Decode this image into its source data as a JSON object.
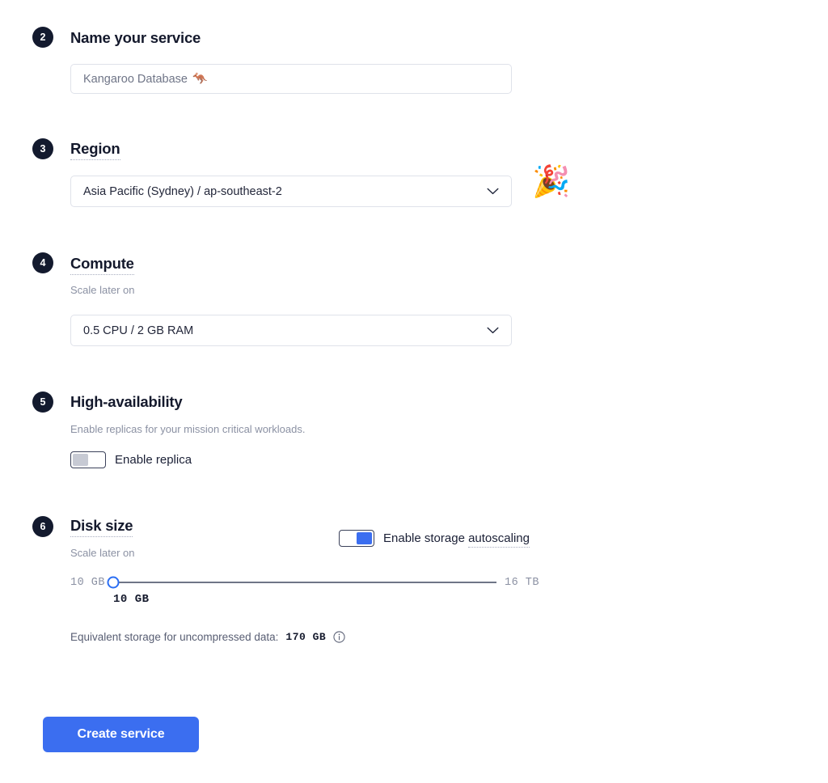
{
  "page": {
    "background": "#ffffff",
    "accent_color": "#3b6ef0",
    "badge_color": "#131a2e",
    "muted_color": "#8b91a3"
  },
  "sections": {
    "name": {
      "step": "2",
      "heading": "Name your service",
      "input_value": "Kangaroo Database",
      "input_emoji": "🦘",
      "input_placeholder": "Kangaroo Database 🦘"
    },
    "region": {
      "step": "3",
      "heading": "Region",
      "selected": "Asia Pacific (Sydney) / ap-southeast-2",
      "side_emoji": "🎉"
    },
    "compute": {
      "step": "4",
      "heading": "Compute",
      "subtitle": "Scale later on",
      "selected": "0.5 CPU / 2 GB RAM"
    },
    "high_availability": {
      "step": "5",
      "heading": "High-availability",
      "subtitle": "Enable replicas for your mission critical workloads.",
      "toggle_label": "Enable replica",
      "toggle_state": "off"
    },
    "disk_size": {
      "step": "6",
      "heading": "Disk size",
      "subtitle": "Scale later on",
      "autoscaling_label_prefix": "Enable storage ",
      "autoscaling_label_suffix": "autoscaling",
      "autoscaling_state": "on",
      "slider": {
        "min_label": "10 GB",
        "max_label": "16 TB",
        "current_label": "10 GB",
        "percent": 0
      },
      "equivalent_storage_label": "Equivalent storage for uncompressed data:",
      "equivalent_storage_value": "170 GB",
      "info_icon": "info-circle-icon"
    }
  },
  "footer": {
    "submit_label": "Create service"
  }
}
